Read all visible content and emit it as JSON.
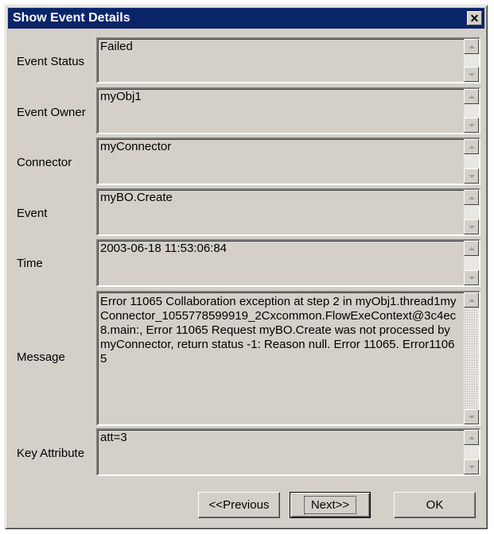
{
  "window": {
    "title": "Show Event Details"
  },
  "fields": {
    "event_status": {
      "label": "Event Status",
      "value": "Failed"
    },
    "event_owner": {
      "label": "Event Owner",
      "value": "myObj1"
    },
    "connector": {
      "label": "Connector",
      "value": "myConnector"
    },
    "event": {
      "label": "Event",
      "value": "myBO.Create"
    },
    "time": {
      "label": "Time",
      "value": "2003-06-18 11:53:06:84"
    },
    "message": {
      "label": "Message",
      "value": "Error 11065 Collaboration exception at step 2 in myObj1.thread1myConnector_1055778599919_2Cxcommon.FlowExeContext@3c4ec8.main:, Error 11065 Request myBO.Create was not processed by myConnector, return status -1: Reason null. Error 11065. Error11065"
    },
    "key_attribute": {
      "label": "Key Attribute",
      "value": "att=3"
    }
  },
  "buttons": {
    "previous": "<<Previous",
    "next": "Next>>",
    "ok": "OK"
  },
  "icons": {
    "close": "close-icon",
    "scroll_up": "arrow-up-icon",
    "scroll_down": "arrow-down-icon"
  },
  "colors": {
    "titlebar": "#0a246a",
    "face": "#d4d0c8"
  }
}
